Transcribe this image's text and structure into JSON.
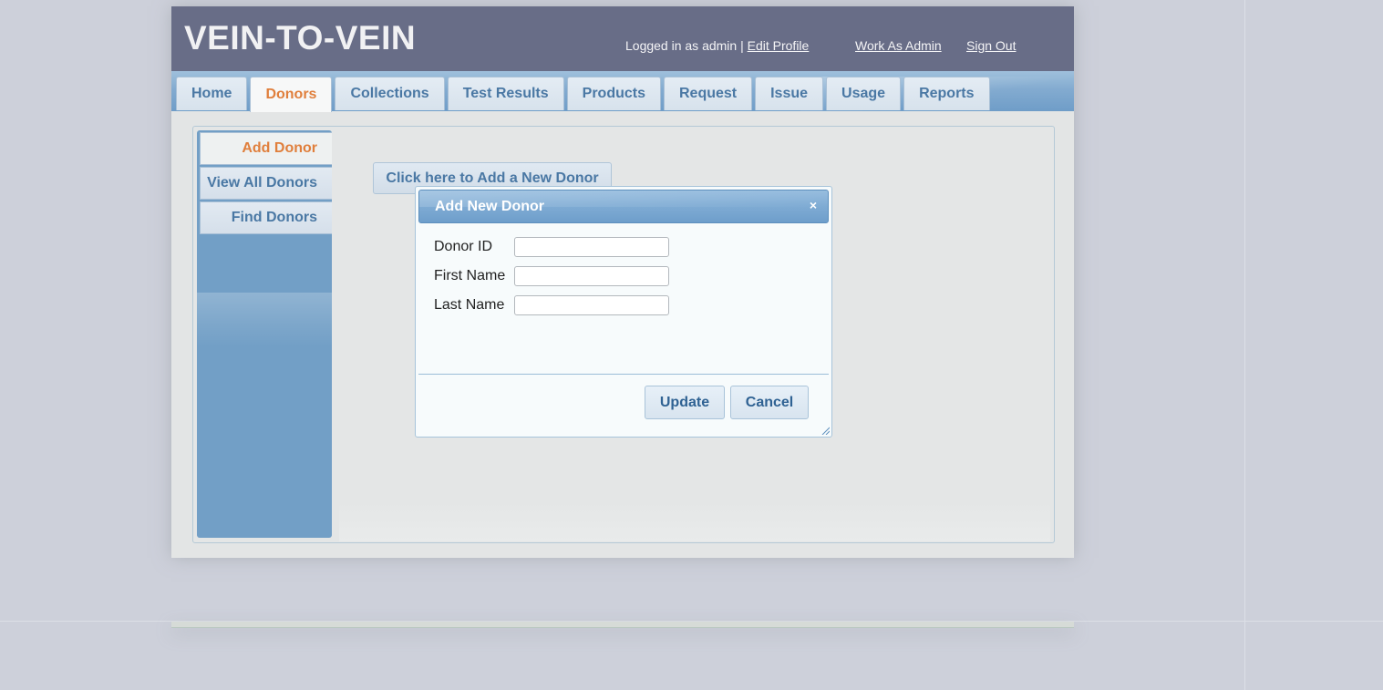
{
  "app": {
    "title": "VEIN-TO-VEIN"
  },
  "header": {
    "logged_in_text": "Logged in as admin |",
    "edit_profile": "Edit Profile",
    "work_as_admin": "Work As Admin",
    "sign_out": "Sign Out"
  },
  "tabs": [
    {
      "label": "Home",
      "active": false
    },
    {
      "label": "Donors",
      "active": true
    },
    {
      "label": "Collections",
      "active": false
    },
    {
      "label": "Test Results",
      "active": false
    },
    {
      "label": "Products",
      "active": false
    },
    {
      "label": "Request",
      "active": false
    },
    {
      "label": "Issue",
      "active": false
    },
    {
      "label": "Usage",
      "active": false
    },
    {
      "label": "Reports",
      "active": false
    }
  ],
  "sidenav": {
    "items": [
      {
        "label": "Add Donor",
        "active": true
      },
      {
        "label": "View All Donors",
        "active": false
      },
      {
        "label": "Find Donors",
        "active": false
      }
    ]
  },
  "main": {
    "add_new_button": "Click here to Add a New Donor"
  },
  "dialog": {
    "title": "Add New Donor",
    "close_glyph": "×",
    "fields": [
      {
        "label": "Donor ID",
        "value": ""
      },
      {
        "label": "First Name",
        "value": ""
      },
      {
        "label": "Last Name",
        "value": ""
      }
    ],
    "update_label": "Update",
    "cancel_label": "Cancel"
  },
  "colors": {
    "header_bg": "#686d87",
    "tab_active_text": "#e07f3c",
    "tab_text": "#4a78a4",
    "sidenav_bg": "#729fc6",
    "dialog_title_bg": "#7ea9d3"
  }
}
